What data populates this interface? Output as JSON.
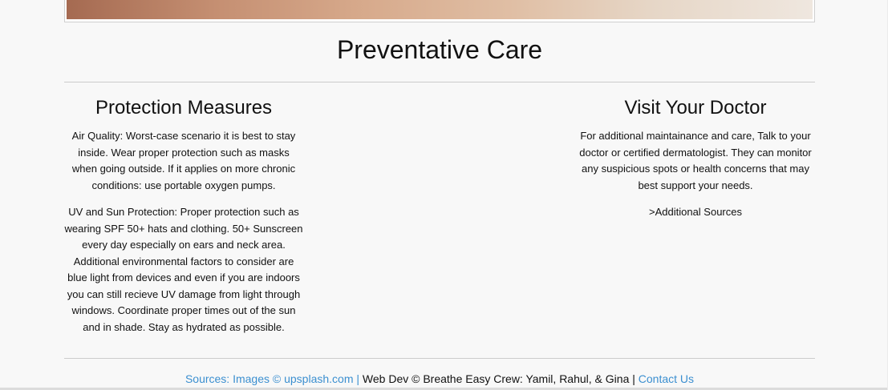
{
  "page": {
    "title": "Preventative Care"
  },
  "sections": {
    "protection": {
      "heading": "Protection Measures",
      "paragraphs": [
        "Air Quality: Worst-case scenario it is best to stay inside. Wear proper protection such as masks when going outside. If it applies on more chronic conditions: use portable oxygen pumps.",
        "UV and Sun Protection: Proper protection such as wearing SPF 50+ hats and clothing. 50+ Sunscreen every day especially on ears and neck area. Additional environmental factors to consider are blue light from devices and even if you are indoors you can still recieve UV damage from light through windows. Coordinate proper times out of the sun and in shade. Stay as hydrated as possible."
      ]
    },
    "doctor": {
      "heading": "Visit Your Doctor",
      "paragraph": "For additional maintainance and care, Talk to your doctor or certified dermatologist. They can monitor any suspicious spots or health concerns that may best support your needs.",
      "link": ">Additional Sources"
    }
  },
  "footer": {
    "sources_link": "Sources: Images © upsplash.com",
    "separator": " | ",
    "credits": "Web Dev © Breathe Easy Crew: Yamil, Rahul, & Gina",
    "separator2": " | ",
    "contact_link": "Contact Us"
  },
  "colors": {
    "background": "#f8f8f8",
    "link": "#3b8fd0",
    "text": "#111111",
    "rule": "#cccccc"
  }
}
